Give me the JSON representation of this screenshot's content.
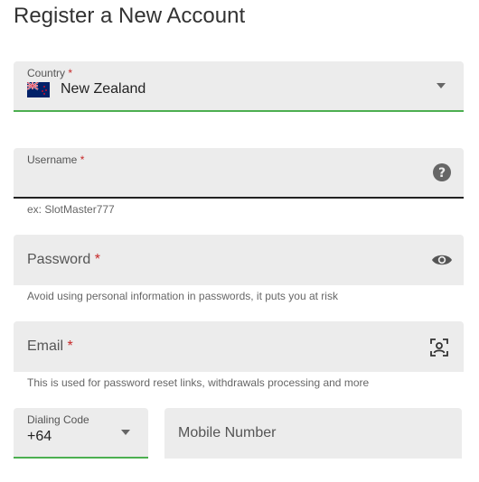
{
  "page": {
    "title": "Register a New Account"
  },
  "country": {
    "label": "Country",
    "required_mark": "*",
    "value": "New Zealand",
    "flag_icon": "nz-flag-icon"
  },
  "username": {
    "label": "Username",
    "required_mark": "*",
    "value": "",
    "helper": "ex: SlotMaster777",
    "icon": "help-icon"
  },
  "password": {
    "label": "Password",
    "required_mark": "*",
    "value": "",
    "helper": "Avoid using personal information in passwords, it puts you at risk",
    "icon": "eye-icon"
  },
  "email": {
    "label": "Email",
    "required_mark": "*",
    "value": "",
    "helper": "This is used for password reset links, withdrawals processing and more",
    "icon": "face-scan-icon"
  },
  "dialing_code": {
    "label": "Dialing Code",
    "value": "+64"
  },
  "mobile": {
    "placeholder": "Mobile Number",
    "value": ""
  },
  "colors": {
    "focus_green": "#4caf50",
    "required_red": "#c62828",
    "field_bg": "#ececec"
  }
}
